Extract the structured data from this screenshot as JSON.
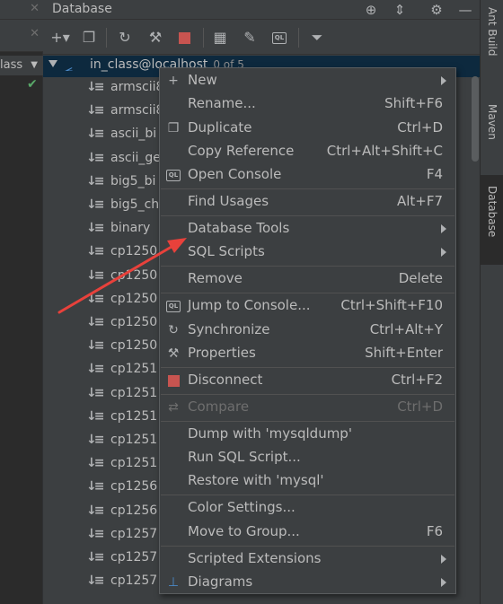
{
  "left_panel": {
    "class_label": "lass",
    "chevron": "chevron-down-icon"
  },
  "database_window": {
    "title": "Database",
    "header_icons": [
      "globe-icon",
      "collapse-icon",
      "gear-icon",
      "minimize-icon"
    ],
    "toolbar_icons": [
      "add-icon",
      "duplicate-icon",
      "refresh-icon",
      "schema-tools-icon",
      "stop-icon",
      "table-icon",
      "edit-icon",
      "console-icon",
      "filter-icon"
    ]
  },
  "tree": {
    "root_label": "in_class@localhost",
    "root_count": "0 of 5",
    "items": [
      "armscii8",
      "armscii8",
      "ascii_bi",
      "ascii_ge",
      "big5_bi",
      "big5_ch",
      "binary",
      "cp1250",
      "cp1250",
      "cp1250",
      "cp1250",
      "cp1250",
      "cp1251",
      "cp1251",
      "cp1251",
      "cp1251",
      "cp1251",
      "cp1256",
      "cp1256",
      "cp1257",
      "cp1257",
      "cp1257"
    ]
  },
  "right_tabs": {
    "ant_build": "Ant Build",
    "maven": "Maven",
    "database": "Database"
  },
  "context_menu": {
    "new": "New",
    "rename": "Rename...",
    "rename_shortcut": "Shift+F6",
    "duplicate": "Duplicate",
    "duplicate_shortcut": "Ctrl+D",
    "copy_reference": "Copy Reference",
    "copy_reference_shortcut": "Ctrl+Alt+Shift+C",
    "open_console": "Open Console",
    "open_console_shortcut": "F4",
    "find_usages": "Find Usages",
    "find_usages_shortcut": "Alt+F7",
    "database_tools": "Database Tools",
    "sql_scripts": "SQL Scripts",
    "remove": "Remove",
    "remove_shortcut": "Delete",
    "jump_to_console": "Jump to Console...",
    "jump_to_console_shortcut": "Ctrl+Shift+F10",
    "synchronize": "Synchronize",
    "synchronize_shortcut": "Ctrl+Alt+Y",
    "properties": "Properties",
    "properties_shortcut": "Shift+Enter",
    "disconnect": "Disconnect",
    "disconnect_shortcut": "Ctrl+F2",
    "compare": "Compare",
    "compare_shortcut": "Ctrl+D",
    "dump": "Dump with 'mysqldump'",
    "run_sql_script": "Run SQL Script...",
    "restore": "Restore with 'mysql'",
    "color_settings": "Color Settings...",
    "move_to_group": "Move to Group...",
    "move_to_group_shortcut": "F6",
    "scripted_extensions": "Scripted Extensions",
    "diagrams": "Diagrams"
  },
  "colors": {
    "background": "#3c3f41",
    "selection": "#0d293e",
    "accent_red": "#c75450",
    "annotation_arrow": "#e8413b",
    "check_green": "#59a869"
  }
}
